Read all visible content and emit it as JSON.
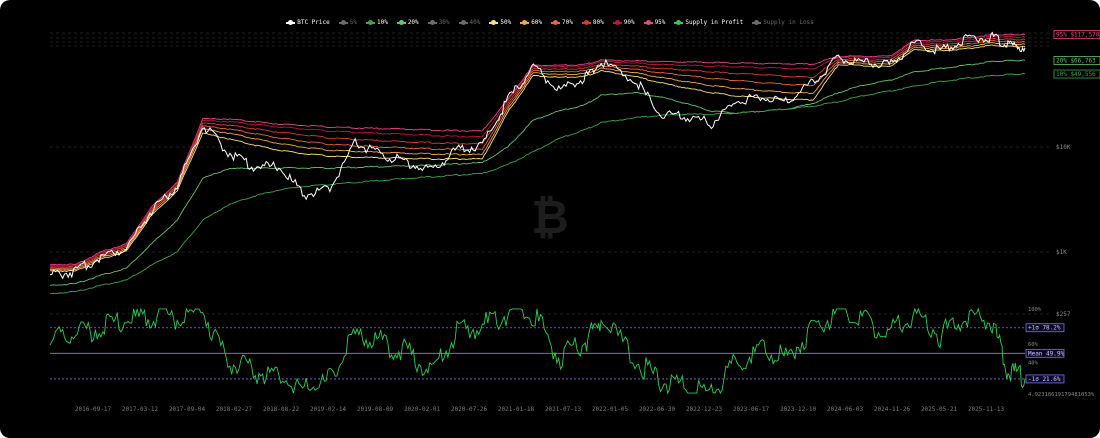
{
  "legend": [
    {
      "label": "BTC Price",
      "color": "#ffffff",
      "active": true
    },
    {
      "label": "5%",
      "color": "#6b6b6b",
      "active": false
    },
    {
      "label": "10%",
      "color": "#3fa34d",
      "active": true
    },
    {
      "label": "20%",
      "color": "#66c36b",
      "active": true
    },
    {
      "label": "30%",
      "color": "#6b6b6b",
      "active": false
    },
    {
      "label": "40%",
      "color": "#6b6b6b",
      "active": false
    },
    {
      "label": "50%",
      "color": "#ffe07a",
      "active": true
    },
    {
      "label": "60%",
      "color": "#f5a44e",
      "active": true
    },
    {
      "label": "70%",
      "color": "#e8653a",
      "active": true
    },
    {
      "label": "80%",
      "color": "#d93a2f",
      "active": true
    },
    {
      "label": "90%",
      "color": "#b8183a",
      "active": true
    },
    {
      "label": "95%",
      "color": "#e8468a",
      "active": true
    },
    {
      "label": "Supply in Profit",
      "color": "#2ecc57",
      "active": true
    },
    {
      "label": "Supply in Loss",
      "color": "#6b6b6b",
      "active": false
    }
  ],
  "price_axis": {
    "ticks": [
      {
        "label": "$10K",
        "value": 10000
      },
      {
        "label": "$1K",
        "value": 1000
      },
      {
        "label": "$257",
        "value": 257
      }
    ],
    "scale": "log"
  },
  "band_labels": [
    {
      "label": "95% $117,570",
      "color": "#e8468a"
    },
    {
      "label": "20% $66,763",
      "color": "#66c36b"
    },
    {
      "label": "10% $49,556",
      "color": "#3fa34d"
    }
  ],
  "oscillator": {
    "ticks": [
      "100%",
      "60%",
      "40%",
      "4.92318619179481053%"
    ],
    "plus1": {
      "label": "+1σ 78.2%",
      "value": 78.2
    },
    "mean": {
      "label": "Mean 49.9%",
      "value": 49.9
    },
    "minus1": {
      "label": "-1σ 21.6%",
      "value": 21.6
    }
  },
  "x_axis": [
    "2016-09-17",
    "2017-03-12",
    "2017-09-04",
    "2018-02-27",
    "2018-08-22",
    "2019-02-14",
    "2019-08-09",
    "2020-02-01",
    "2020-07-26",
    "2021-01-18",
    "2021-07-13",
    "2022-01-05",
    "2022-06-30",
    "2022-12-23",
    "2023-06-17",
    "2023-12-10",
    "2024-06-03",
    "2024-11-26",
    "2025-05-21",
    "2025-11-13"
  ],
  "chart_data": [
    {
      "type": "line",
      "title": "",
      "scale": "log",
      "x": [
        "2016-06",
        "2016-09",
        "2016-12",
        "2017-03",
        "2017-06",
        "2017-09",
        "2017-12",
        "2018-03",
        "2018-06",
        "2018-09",
        "2018-12",
        "2019-03",
        "2019-06",
        "2019-09",
        "2019-12",
        "2020-03",
        "2020-06",
        "2020-09",
        "2020-12",
        "2021-03",
        "2021-06",
        "2021-09",
        "2021-11",
        "2022-03",
        "2022-06",
        "2022-09",
        "2022-12",
        "2023-03",
        "2023-06",
        "2023-09",
        "2023-12",
        "2024-03",
        "2024-06",
        "2024-09",
        "2024-12",
        "2025-03",
        "2025-06",
        "2025-09",
        "2025-11",
        "2026-01"
      ],
      "series": [
        {
          "name": "BTC Price",
          "color": "#ffffff",
          "values": [
            600,
            650,
            900,
            1100,
            2500,
            4200,
            16000,
            9000,
            6500,
            6500,
            3500,
            4000,
            11000,
            8500,
            7200,
            6000,
            9400,
            10500,
            28000,
            58000,
            35000,
            45000,
            64000,
            44000,
            20000,
            19500,
            16800,
            27000,
            30000,
            27000,
            42000,
            70000,
            64000,
            60000,
            98000,
            84000,
            106000,
            112000,
            92000,
            88000
          ]
        },
        {
          "name": "95%",
          "color": "#e8468a",
          "values": [
            760,
            760,
            1000,
            1200,
            2700,
            4600,
            18500,
            18500,
            17500,
            16500,
            16000,
            15500,
            15200,
            15000,
            14800,
            14500,
            14300,
            14200,
            28500,
            60000,
            60000,
            61000,
            67000,
            66000,
            65000,
            64500,
            64000,
            63000,
            62500,
            62000,
            61500,
            73000,
            73000,
            73000,
            104000,
            104000,
            109000,
            117000,
            117570,
            117570
          ]
        },
        {
          "name": "90%",
          "color": "#b8183a",
          "values": [
            740,
            740,
            970,
            1170,
            2650,
            4500,
            17800,
            17500,
            16500,
            15500,
            14800,
            14200,
            13800,
            13500,
            13200,
            12900,
            12600,
            12500,
            27500,
            58500,
            58000,
            59000,
            65000,
            63000,
            61000,
            60000,
            59000,
            58000,
            57000,
            56000,
            55500,
            71500,
            71000,
            70500,
            101000,
            100000,
            105000,
            113000,
            112000,
            111000
          ]
        },
        {
          "name": "80%",
          "color": "#d93a2f",
          "values": [
            720,
            720,
            940,
            1140,
            2550,
            4350,
            16800,
            16200,
            15000,
            13800,
            13000,
            12200,
            11800,
            11500,
            11200,
            11000,
            10800,
            10700,
            26000,
            56000,
            55000,
            56000,
            62000,
            59000,
            56000,
            54000,
            52000,
            50000,
            49000,
            47000,
            46000,
            69000,
            68000,
            67000,
            97000,
            95000,
            100000,
            108000,
            106000,
            105000
          ]
        },
        {
          "name": "70%",
          "color": "#e8653a",
          "values": [
            700,
            700,
            910,
            1100,
            2450,
            4200,
            15800,
            14900,
            13500,
            12200,
            11300,
            10600,
            10300,
            10000,
            9800,
            9600,
            9500,
            9500,
            24500,
            53500,
            52000,
            53000,
            59000,
            55000,
            51000,
            48000,
            45000,
            43000,
            41000,
            39500,
            38500,
            66500,
            65500,
            64000,
            93000,
            91000,
            95000,
            103000,
            101000,
            100000
          ]
        },
        {
          "name": "60%",
          "color": "#f5a44e",
          "values": [
            680,
            680,
            880,
            1060,
            2350,
            4000,
            14800,
            13600,
            12100,
            10800,
            9900,
            9300,
            9100,
            8900,
            8700,
            8600,
            8500,
            8500,
            23000,
            51000,
            49000,
            50000,
            56000,
            51000,
            46000,
            42000,
            38500,
            36000,
            34500,
            33000,
            32500,
            64000,
            62500,
            61000,
            89000,
            87000,
            90000,
            98000,
            96000,
            95000
          ]
        },
        {
          "name": "50%",
          "color": "#ffe07a",
          "values": [
            660,
            660,
            850,
            1020,
            2250,
            3800,
            13500,
            12000,
            10500,
            9300,
            8600,
            8200,
            8000,
            7900,
            7800,
            7700,
            7700,
            7700,
            21500,
            48000,
            46000,
            47000,
            53000,
            47000,
            41000,
            36500,
            33000,
            30500,
            29500,
            28500,
            28000,
            61000,
            59500,
            58000,
            85000,
            83000,
            86000,
            93000,
            91000,
            90000
          ]
        },
        {
          "name": "20%",
          "color": "#66c36b",
          "values": [
            480,
            500,
            600,
            700,
            1200,
            2000,
            5000,
            6200,
            6300,
            6300,
            6300,
            6300,
            6400,
            6500,
            6600,
            6700,
            6900,
            7100,
            10000,
            18000,
            22000,
            25000,
            31000,
            33000,
            30000,
            26000,
            22000,
            21000,
            22000,
            23000,
            26000,
            33000,
            39000,
            43000,
            52000,
            56000,
            60000,
            65000,
            66500,
            66763
          ]
        },
        {
          "name": "10%",
          "color": "#3fa34d",
          "values": [
            400,
            420,
            480,
            540,
            750,
            1000,
            2000,
            2800,
            3400,
            3900,
            4200,
            4400,
            4600,
            4800,
            5000,
            5200,
            5400,
            5600,
            6800,
            9000,
            12000,
            14500,
            17000,
            19000,
            20000,
            20500,
            20500,
            21000,
            22000,
            23000,
            24500,
            27000,
            31000,
            34000,
            38000,
            42000,
            45000,
            47500,
            49000,
            49556
          ]
        }
      ],
      "ytick_labels": [
        "$10K",
        "$1K",
        "$257"
      ]
    },
    {
      "type": "line",
      "title": "",
      "x": [
        "2016-06",
        "2016-09",
        "2016-12",
        "2017-03",
        "2017-06",
        "2017-09",
        "2017-12",
        "2018-03",
        "2018-06",
        "2018-09",
        "2018-12",
        "2019-03",
        "2019-06",
        "2019-09",
        "2019-12",
        "2020-03",
        "2020-06",
        "2020-09",
        "2020-12",
        "2021-03",
        "2021-06",
        "2021-09",
        "2021-11",
        "2022-03",
        "2022-06",
        "2022-09",
        "2022-12",
        "2023-03",
        "2023-06",
        "2023-09",
        "2023-12",
        "2024-03",
        "2024-06",
        "2024-09",
        "2024-12",
        "2025-03",
        "2025-06",
        "2025-09",
        "2025-11",
        "2026-01"
      ],
      "series": [
        {
          "name": "Supply in Profit",
          "color": "#2ecc57",
          "values": [
            62,
            72,
            78,
            85,
            92,
            90,
            96,
            40,
            30,
            25,
            10,
            20,
            70,
            62,
            52,
            28,
            72,
            80,
            95,
            94,
            45,
            60,
            88,
            42,
            20,
            10,
            5,
            40,
            55,
            45,
            80,
            96,
            85,
            72,
            95,
            70,
            92,
            88,
            28,
            22
          ]
        }
      ],
      "ylim": [
        4.9231861917948105,
        100
      ],
      "ytick_labels": [
        "100%",
        "60%",
        "40%",
        "4.92318619179481053%"
      ],
      "reference_lines": [
        {
          "label": "+1σ 78.2%",
          "value": 78.2
        },
        {
          "label": "Mean 49.9%",
          "value": 49.9
        },
        {
          "label": "-1σ 21.6%",
          "value": 21.6
        }
      ]
    }
  ]
}
